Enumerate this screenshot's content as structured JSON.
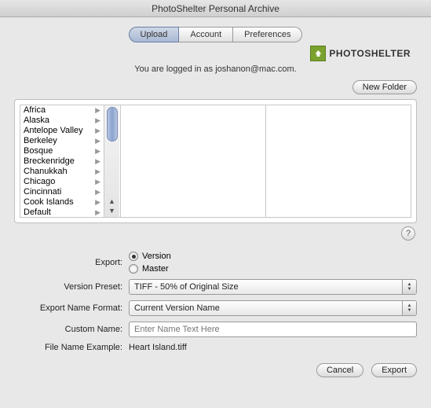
{
  "title": "PhotoShelter Personal Archive",
  "tabs": [
    "Upload",
    "Account",
    "Preferences"
  ],
  "active_tab": 0,
  "brand": "PHOTOSHELTER",
  "login_line": "You are logged in as joshanon@mac.com.",
  "new_folder": "New Folder",
  "folders": [
    "Africa",
    "Alaska",
    "Antelope Valley",
    "Berkeley",
    "Bosque",
    "Breckenridge",
    "Chanukkah",
    "Chicago",
    "Cincinnati",
    "Cook Islands",
    "Default"
  ],
  "help_label": "?",
  "labels": {
    "export": "Export:",
    "version_preset": "Version Preset:",
    "export_name_format": "Export Name Format:",
    "custom_name": "Custom Name:",
    "file_name_example": "File Name Example:"
  },
  "export_radios": {
    "version": "Version",
    "master": "Master",
    "selected": "version"
  },
  "version_preset_value": "TIFF - 50% of Original Size",
  "export_name_format_value": "Current Version Name",
  "custom_name_placeholder": "Enter Name Text Here",
  "file_name_example_value": "Heart Island.tiff",
  "buttons": {
    "cancel": "Cancel",
    "export": "Export"
  }
}
